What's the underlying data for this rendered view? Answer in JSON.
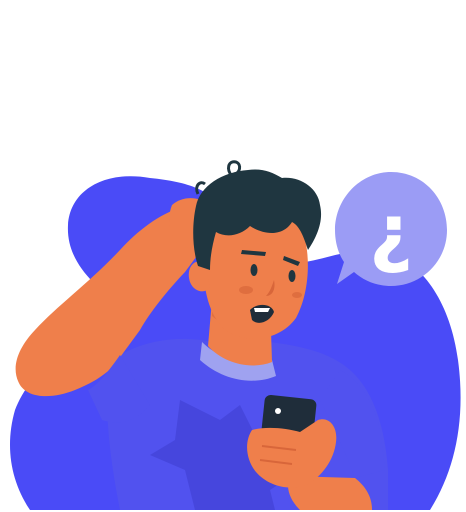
{
  "illustration": {
    "speech_bubble_symbol": "¿",
    "colors": {
      "background": "#ffffff",
      "blob": "#4a4bf7",
      "shirt": "#5152ef",
      "shirt_shadow": "#4242d6",
      "skin": "#ef7f4b",
      "skin_shadow": "#d8663a",
      "hair": "#1f3640",
      "bubble": "#9b9cf5",
      "bubble_symbol": "#ffffff",
      "phone": "#1f2d3a",
      "collar": "#9fa2f0"
    },
    "icons": [
      "confused-man-illustration",
      "speech-bubble-icon",
      "smartphone-icon"
    ]
  }
}
